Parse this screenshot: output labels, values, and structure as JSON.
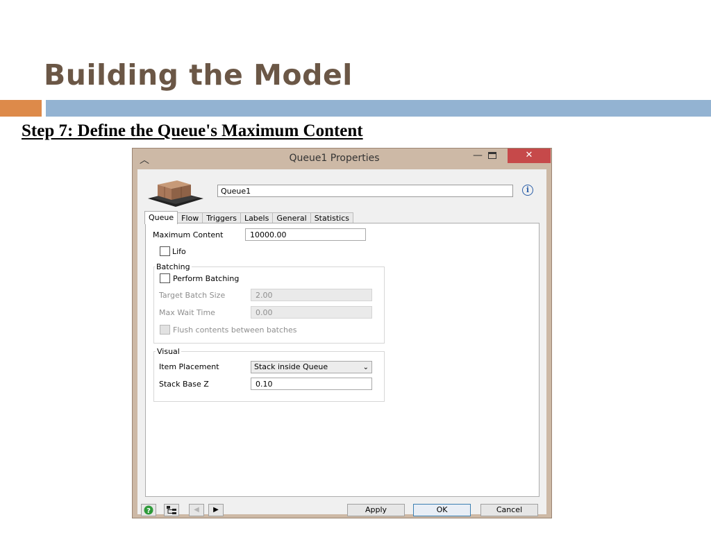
{
  "slide": {
    "title": "Building the Model",
    "step_heading": "Step 7: Define the Queue's Maximum Content"
  },
  "dialog": {
    "title": "Queue1  Properties",
    "close_symbol": "✕",
    "object_name": "Queue1",
    "info_symbol": "i",
    "tabs": [
      "Queue",
      "Flow",
      "Triggers",
      "Labels",
      "General",
      "Statistics"
    ],
    "queue": {
      "max_content_label": "Maximum Content",
      "max_content_value": "10000.00",
      "lifo_label": "Lifo",
      "lifo_checked": false,
      "batching": {
        "title": "Batching",
        "perform_label": "Perform Batching",
        "perform_checked": false,
        "target_size_label": "Target Batch Size",
        "target_size_value": "2.00",
        "max_wait_label": "Max Wait Time",
        "max_wait_value": "0.00",
        "flush_label": "Flush contents between batches"
      },
      "visual": {
        "title": "Visual",
        "placement_label": "Item Placement",
        "placement_value": "Stack inside Queue",
        "base_z_label": "Stack Base Z",
        "base_z_value": "0.10"
      }
    },
    "footer": {
      "apply": "Apply",
      "ok": "OK",
      "cancel": "Cancel"
    }
  },
  "colors": {
    "title_brown": "#6b5746",
    "accent_orange": "#dd8a4a",
    "accent_blue": "#93b3d2",
    "window_frame": "#cdb9a6",
    "close_red": "#c6494a"
  }
}
